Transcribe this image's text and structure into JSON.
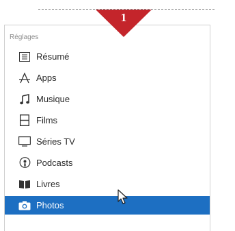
{
  "callout": {
    "number": "1",
    "color": "#c4252b"
  },
  "panel": {
    "section_header": "Réglages",
    "selected_color": "#1d6fc2",
    "items": [
      {
        "label": "Résumé",
        "icon": "summary-list-icon"
      },
      {
        "label": "Apps",
        "icon": "apps-a-icon"
      },
      {
        "label": "Musique",
        "icon": "music-note-icon"
      },
      {
        "label": "Films",
        "icon": "film-strip-icon"
      },
      {
        "label": "Séries TV",
        "icon": "tv-monitor-icon"
      },
      {
        "label": "Podcasts",
        "icon": "podcast-icon"
      },
      {
        "label": "Livres",
        "icon": "book-icon"
      },
      {
        "label": "Photos",
        "icon": "camera-icon",
        "selected": true
      }
    ]
  }
}
